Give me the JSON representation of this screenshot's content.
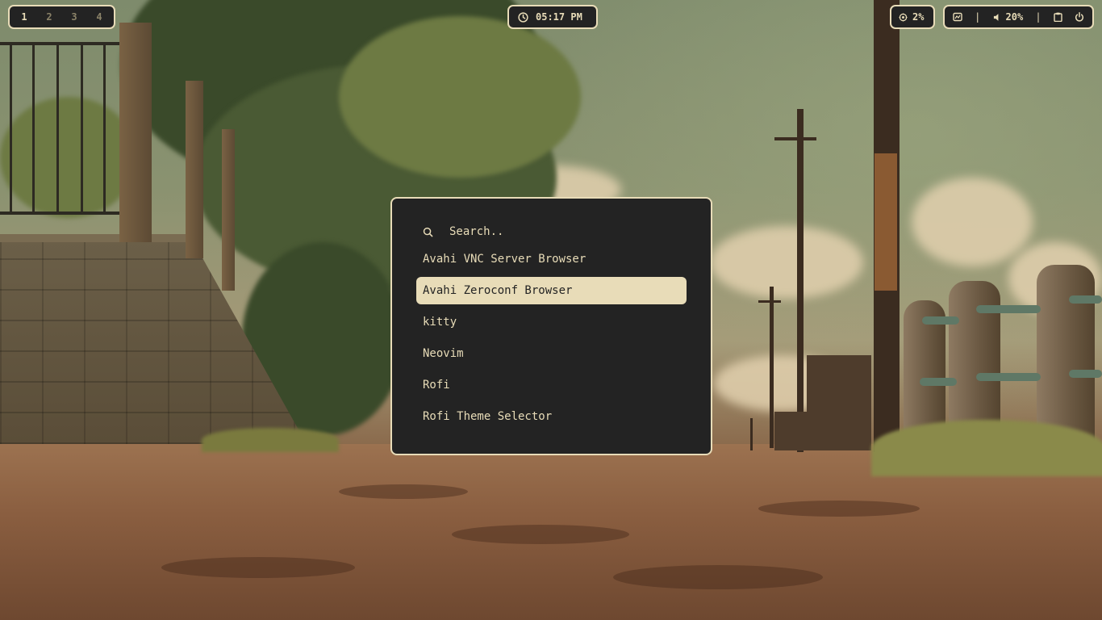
{
  "workspaces": [
    {
      "label": "1",
      "active": true
    },
    {
      "label": "2",
      "active": false
    },
    {
      "label": "3",
      "active": false
    },
    {
      "label": "4",
      "active": false
    }
  ],
  "clock": {
    "icon": "clock-icon",
    "time": "05:17 PM"
  },
  "cpu": {
    "icon": "cpu-icon",
    "value": "2%"
  },
  "status": {
    "network_icon": "network-icon",
    "volume_icon": "volume-icon",
    "volume": "20%",
    "clipboard_icon": "clipboard-icon",
    "power_icon": "power-icon",
    "separator": "|"
  },
  "launcher": {
    "search_icon": "search-icon",
    "placeholder": "Search..",
    "results": [
      {
        "label": "Avahi VNC Server Browser",
        "selected": false
      },
      {
        "label": "Avahi Zeroconf Browser",
        "selected": true
      },
      {
        "label": "kitty",
        "selected": false
      },
      {
        "label": "Neovim",
        "selected": false
      },
      {
        "label": "Rofi",
        "selected": false
      },
      {
        "label": "Rofi Theme Selector",
        "selected": false
      }
    ]
  },
  "colors": {
    "panel_bg": "#232323",
    "accent": "#e8dcb8",
    "inactive": "#8a8268"
  }
}
